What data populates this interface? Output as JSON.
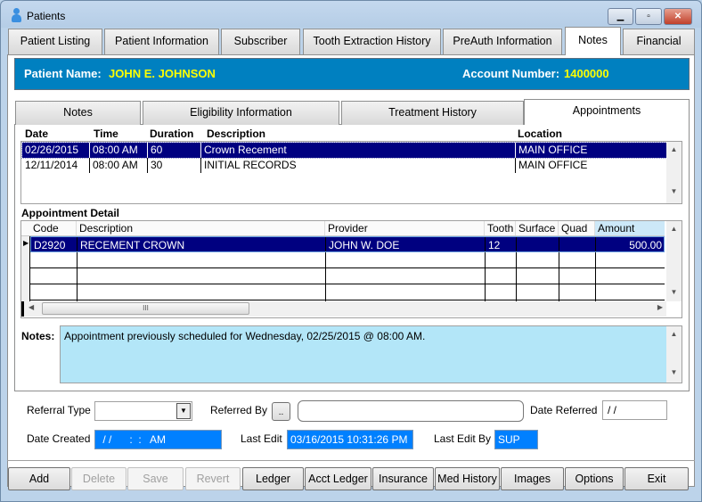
{
  "window": {
    "title": "Patients",
    "minimize": "▁",
    "maximize": "▫",
    "close": "✕"
  },
  "tabs": [
    {
      "label": "Patient Listing"
    },
    {
      "label": "Patient Information"
    },
    {
      "label": "Subscriber"
    },
    {
      "label": "Tooth Extraction History"
    },
    {
      "label": "PreAuth Information"
    },
    {
      "label": "Notes",
      "active": true
    },
    {
      "label": "Financial"
    }
  ],
  "header": {
    "patient_name_label": "Patient Name:",
    "patient_name": "JOHN E. JOHNSON",
    "account_label": "Account Number:",
    "account_number": "1400000",
    "bg_color": "#0080c0",
    "value_color": "#ffff00"
  },
  "subtabs": [
    {
      "label": "Notes"
    },
    {
      "label": "Eligibility Information"
    },
    {
      "label": "Treatment History"
    },
    {
      "label": "Appointments",
      "active": true
    }
  ],
  "appointments": {
    "columns": [
      "Date",
      "Time",
      "Duration",
      "Description",
      "Location"
    ],
    "rows": [
      {
        "date": "02/26/2015",
        "time": "08:00 AM",
        "duration": "60",
        "description": "Crown Recement",
        "location": "MAIN OFFICE",
        "selected": true
      },
      {
        "date": "12/11/2014",
        "time": "08:00 AM",
        "duration": "30",
        "description": "INITIAL RECORDS",
        "location": "MAIN OFFICE"
      }
    ]
  },
  "detail": {
    "title": "Appointment Detail",
    "columns": [
      "Code",
      "Description",
      "Provider",
      "Tooth",
      "Surface",
      "Quad",
      "Amount"
    ],
    "rows": [
      {
        "code": "D2920",
        "description": "RECEMENT CROWN",
        "provider": "JOHN W. DOE",
        "tooth": "12",
        "surface": "",
        "quad": "",
        "amount": "500.00"
      }
    ],
    "hscroll_grip": "III"
  },
  "notes": {
    "label": "Notes:",
    "text": "Appointment previously scheduled for Wednesday, 02/25/2015 @ 08:00 AM."
  },
  "form": {
    "referral_type_label": "Referral Type",
    "referral_type": "",
    "referred_by_label": "Referred By",
    "referred_by_button": "..",
    "referred_by": "",
    "date_referred_label": "Date Referred",
    "date_referred": " / /",
    "date_created_label": "Date Created",
    "date_created": " / /      :  :   AM",
    "last_edit_label": "Last Edit",
    "last_edit": "03/16/2015 10:31:26 PM",
    "last_edit_by_label": "Last Edit By",
    "last_edit_by": "SUP"
  },
  "buttons": [
    {
      "label": "Add",
      "enabled": true
    },
    {
      "label": "Delete",
      "enabled": false
    },
    {
      "label": "Save",
      "enabled": false
    },
    {
      "label": "Revert",
      "enabled": false
    },
    {
      "label": "Ledger",
      "enabled": true
    },
    {
      "label": "Acct Ledger",
      "enabled": true
    },
    {
      "label": "Insurance",
      "enabled": true
    },
    {
      "label": "Med History",
      "enabled": true
    },
    {
      "label": "Images",
      "enabled": true
    },
    {
      "label": "Options",
      "enabled": true
    },
    {
      "label": "Exit",
      "enabled": true
    }
  ]
}
